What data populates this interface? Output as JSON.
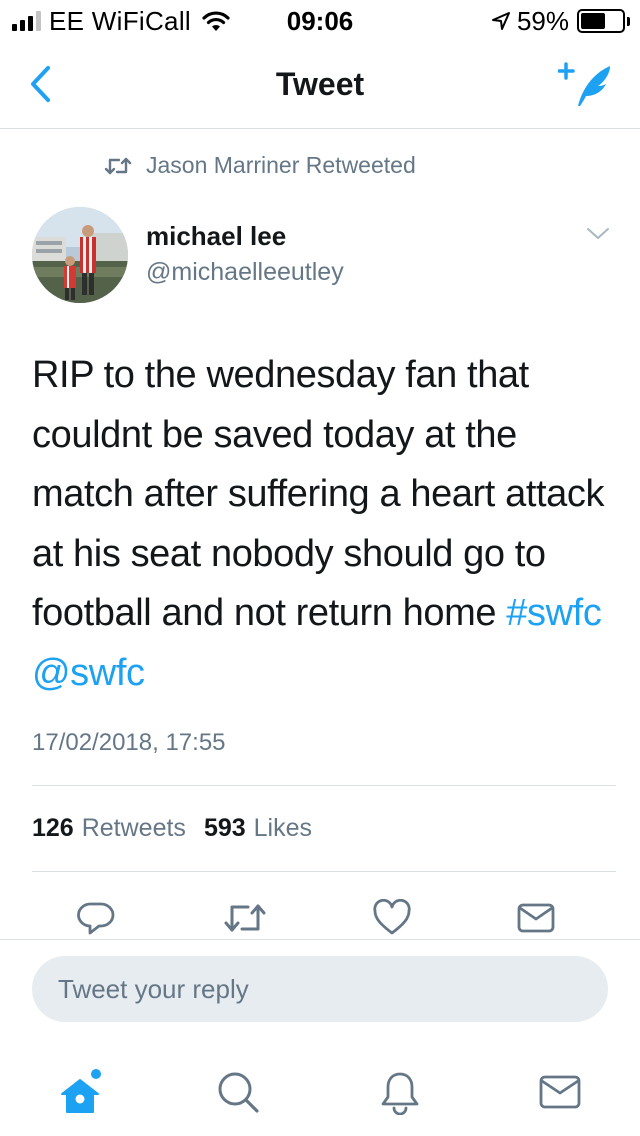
{
  "status_bar": {
    "carrier": "EE WiFiCall",
    "time": "09:06",
    "battery_percent_text": "59%",
    "battery_level": 0.59,
    "signal_bars_filled": 3,
    "signal_bars_total": 4
  },
  "nav": {
    "title": "Tweet",
    "back_icon": "chevron-left-icon",
    "compose_icon": "compose-tweet-icon"
  },
  "retweet_header": {
    "icon": "retweet-icon",
    "label": "Jason Marriner Retweeted"
  },
  "tweet": {
    "author_name": "michael lee",
    "author_handle": "@michaelleeutley",
    "text_plain": "RIP to the wednesday fan that couldnt be saved today at the match after suffering a heart attack at his seat nobody should go to football and not return home",
    "hashtag": "#swfc",
    "mention": "@swfc",
    "timestamp": "17/02/2018, 17:55",
    "retweet_count": "126",
    "retweet_label": "Retweets",
    "like_count": "593",
    "like_label": "Likes"
  },
  "actions": [
    "reply-icon",
    "retweet-icon",
    "like-icon",
    "share-icon"
  ],
  "reply_box": {
    "placeholder": "Tweet your reply"
  },
  "tab_bar": {
    "tabs": [
      "home-icon",
      "search-icon",
      "notifications-icon",
      "messages-icon"
    ],
    "active": "home-icon"
  },
  "colors": {
    "accent": "#1da1f2",
    "secondary_text": "#657786",
    "primary_text": "#14171a",
    "icon_gray": "#657786",
    "divider": "#dadfe3",
    "reply_bg": "#e6ecf0"
  }
}
